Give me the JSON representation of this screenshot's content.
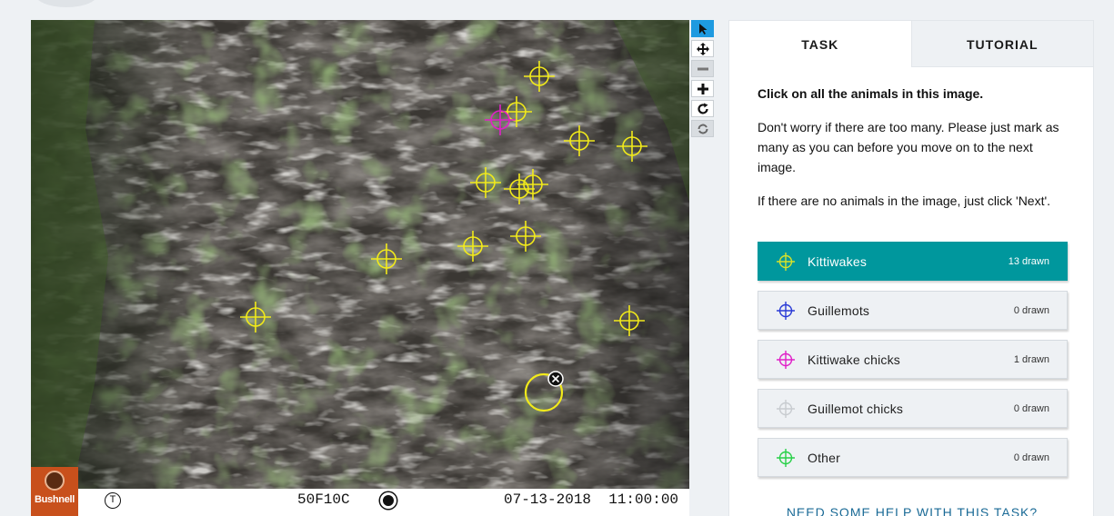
{
  "viewer": {
    "footer": {
      "brand": "Bushnell",
      "camera_id": "50F10C",
      "datetime": "07-13-2018  11:00:00",
      "temp_symbol": "T"
    }
  },
  "toolbar": {
    "tools": [
      {
        "name": "pointer-icon",
        "state": "active"
      },
      {
        "name": "move-icon",
        "state": "normal"
      },
      {
        "name": "zoom-out-icon",
        "state": "disabled"
      },
      {
        "name": "zoom-in-icon",
        "state": "normal"
      },
      {
        "name": "rotate-icon",
        "state": "normal"
      },
      {
        "name": "reset-icon",
        "state": "disabled"
      }
    ]
  },
  "panel": {
    "tabs": {
      "task": "TASK",
      "tutorial": "TUTORIAL"
    },
    "question": "Click on all the animals in this image.",
    "paragraph1": "Don't worry if there are too many. Please just mark as many as you can before you move on to the next image.",
    "paragraph2": "If there are no animals in the image, just click 'Next'.",
    "choices": [
      {
        "label": "Kittiwakes",
        "count": "13 drawn",
        "color": "#d8e22a",
        "selected": true
      },
      {
        "label": "Guillemots",
        "count": "0 drawn",
        "color": "#2a3bd6",
        "selected": false
      },
      {
        "label": "Kittiwake chicks",
        "count": "1 drawn",
        "color": "#e020c8",
        "selected": false
      },
      {
        "label": "Guillemot chicks",
        "count": "0 drawn",
        "color": "#c8ccd0",
        "selected": false
      },
      {
        "label": "Other",
        "count": "0 drawn",
        "color": "#28d048",
        "selected": false
      }
    ],
    "help_link": "NEED SOME HELP WITH THIS TASK?"
  },
  "colors": {
    "accent": "#00979d",
    "kittiwake_mark": "#f2ea1a",
    "chick_mark": "#e020c8",
    "active_tool": "#1e9ae0"
  }
}
